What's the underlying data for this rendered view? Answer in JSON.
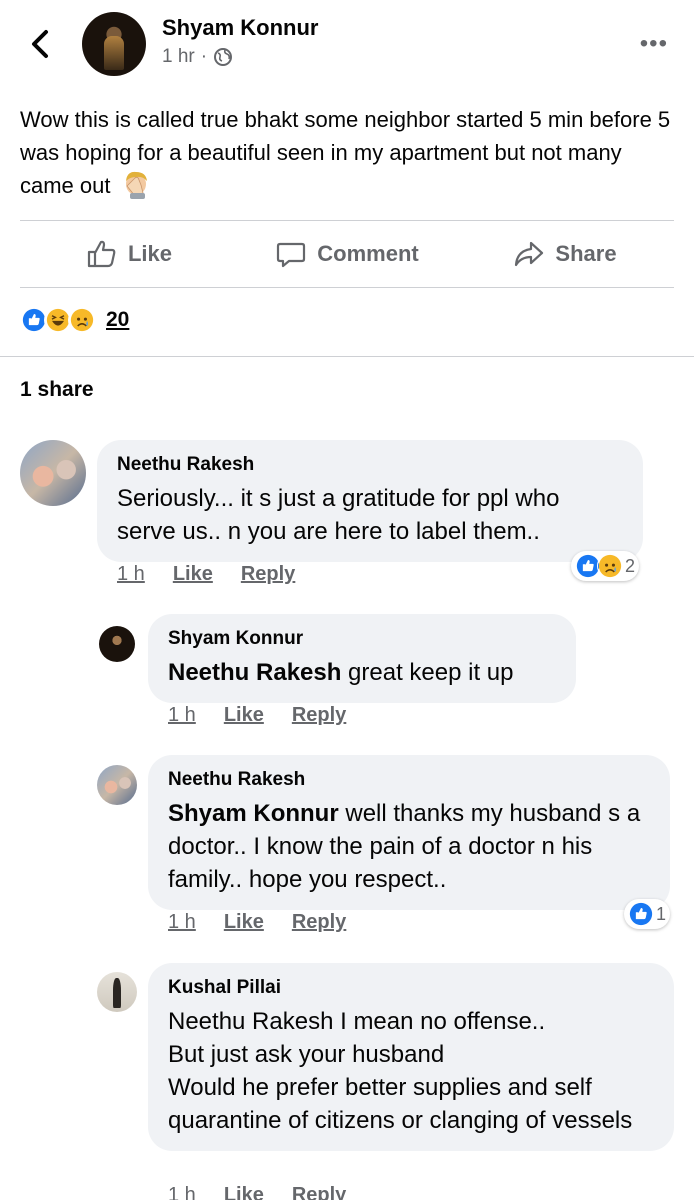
{
  "post": {
    "author": "Shyam Konnur",
    "time": "1 hr",
    "privacy_icon": "globe-icon",
    "menu_icon": "more-options-icon",
    "text": "Wow this is called true bhakt some neighbor started 5 min before 5 was hoping for a beautiful seen in my apartment but not many came out",
    "emoji": "face-palm-emoji"
  },
  "actions": {
    "like": "Like",
    "comment": "Comment",
    "share": "Share"
  },
  "reactions": {
    "icons": [
      "like-icon",
      "haha-icon",
      "sad-icon"
    ],
    "count": "20"
  },
  "shares_text": "1 share",
  "comments": [
    {
      "author": "Neethu Rakesh",
      "text": "Seriously... it s just a gratitude for ppl who serve us.. n you are here to label them..",
      "time": "1 h",
      "like": "Like",
      "reply": "Reply",
      "reactions": [
        "like-icon",
        "sad-icon"
      ],
      "reaction_count": "2"
    },
    {
      "author": "Shyam Konnur",
      "tag": "Neethu Rakesh",
      "text": " great keep it up",
      "time": "1 h",
      "like": "Like",
      "reply": "Reply"
    },
    {
      "author": "Neethu Rakesh",
      "tag": "Shyam Konnur",
      "text": " well thanks my husband s a doctor.. I know the pain of a doctor n his family.. hope you respect..",
      "time": "1 h",
      "like": "Like",
      "reply": "Reply",
      "reactions": [
        "like-icon"
      ],
      "reaction_count": "1"
    },
    {
      "author": "Kushal Pillai",
      "lines": [
        "Neethu Rakesh I mean no offense..",
        "But just ask your husband",
        "Would he prefer better supplies and self quarantine of citizens or clanging of vessels"
      ],
      "time": "1 h",
      "like": "Like",
      "reply": "Reply"
    }
  ],
  "colors": {
    "like_blue": "#1877f2",
    "reaction_yellow": "#f7b928",
    "muted_text": "#65676b",
    "bubble_bg": "#f0f2f5"
  }
}
